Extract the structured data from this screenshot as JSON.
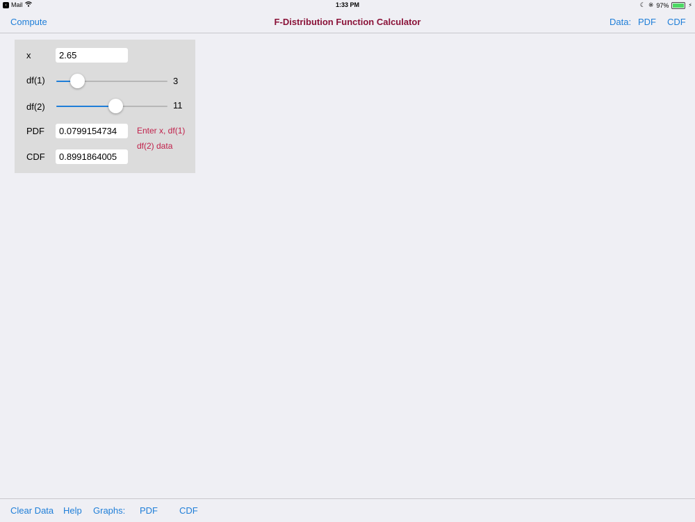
{
  "status_bar": {
    "back_app": "Mail",
    "time": "1:33 PM",
    "battery_text": "97%",
    "battery_level": 0.97
  },
  "nav": {
    "compute_label": "Compute",
    "title": "F-Distribution Function Calculator",
    "data_label": "Data:",
    "pdf_label": "PDF",
    "cdf_label": "CDF"
  },
  "panel": {
    "x_label": "x",
    "x_value": "2.65",
    "df1_label": "df(1)",
    "df1_value": "3",
    "df1_fraction": 0.19,
    "df2_label": "df(2)",
    "df2_value": "11",
    "df2_fraction": 0.53,
    "pdf_label": "PDF",
    "pdf_value": "0.0799154734",
    "cdf_label": "CDF",
    "cdf_value": "0.8991864005",
    "hint_line1": "Enter x, df(1)",
    "hint_line2": "df(2) data"
  },
  "toolbar": {
    "clear_label": "Clear Data",
    "help_label": "Help",
    "graphs_label": "Graphs:",
    "pdf_label": "PDF",
    "cdf_label": "CDF"
  },
  "colors": {
    "accent": "#1e7ed8",
    "title": "#8a1238",
    "hint": "#c0204a",
    "background": "#efeff4",
    "panel": "#dcdcdc"
  }
}
